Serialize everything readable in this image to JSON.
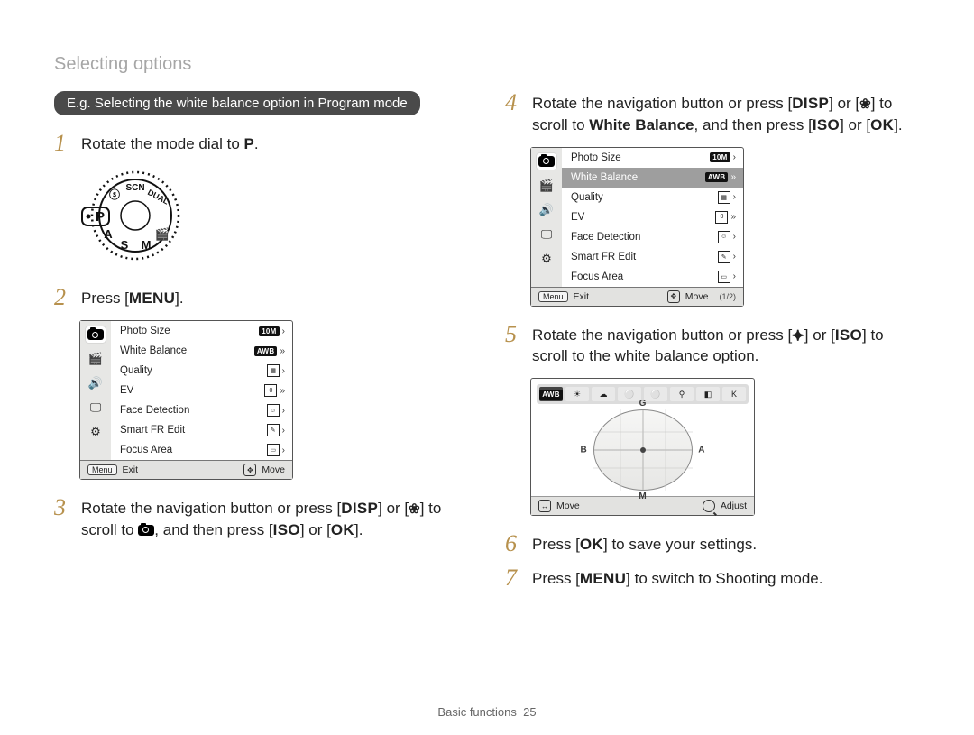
{
  "header": "Selecting options",
  "callout": "E.g. Selecting the white balance option in Program mode",
  "steps": {
    "s1_pre": "Rotate the mode dial to ",
    "s1_mode": "P",
    "s1_post": ".",
    "s2_pre": "Press [",
    "s2_btn": "MENU",
    "s2_post": "].",
    "s3_pre": "Rotate the navigation button or press [",
    "s3_b1": "DISP",
    "s3_mid1": "] or [",
    "s3_flower": "❀",
    "s3_mid2": "] to scroll to ",
    "s3_mid3": ", and then press [",
    "s3_b2": "ISO",
    "s3_mid4": "] or [",
    "s3_b3": "OK",
    "s3_post": "].",
    "s4_pre": "Rotate the navigation button or press [",
    "s4_b1": "DISP",
    "s4_mid1": "] or [",
    "s4_flower": "❀",
    "s4_mid2": "] to scroll to ",
    "s4_target": "White Balance",
    "s4_mid3": ", and then press [",
    "s4_b2": "ISO",
    "s4_mid4": "] or [",
    "s4_b3": "OK",
    "s4_post": "].",
    "s5_pre": "Rotate the navigation button or press [",
    "s5_b1": "⯌",
    "s5_mid1": "] or [",
    "s5_b2": "ISO",
    "s5_post": "] to scroll to the white balance option.",
    "s6_pre": "Press [",
    "s6_b1": "OK",
    "s6_post": "] to save your settings.",
    "s7_pre": "Press [",
    "s7_b1": "MENU",
    "s7_post": "] to switch to Shooting mode."
  },
  "menu": {
    "rows": [
      {
        "label": "Photo Size",
        "value": "10M"
      },
      {
        "label": "White Balance",
        "value": "AWB"
      },
      {
        "label": "Quality",
        "value": ""
      },
      {
        "label": "EV",
        "value": "0"
      },
      {
        "label": "Face Detection",
        "value": ""
      },
      {
        "label": "Smart FR Edit",
        "value": ""
      },
      {
        "label": "Focus Area",
        "value": ""
      }
    ],
    "footer": {
      "menu_pill": "Menu",
      "exit": "Exit",
      "move": "Move",
      "page": "(1/2)"
    }
  },
  "menu2_selected_index": 1,
  "wb": {
    "options": [
      "AWB",
      "☀",
      "☁",
      "⚪",
      "⚪",
      "⚲",
      "◧",
      "K"
    ],
    "chips_sel": 0,
    "axes": {
      "g": "G",
      "m": "M",
      "b": "B",
      "a": "A"
    },
    "footer": {
      "move": "Move",
      "adjust": "Adjust"
    }
  },
  "footer": {
    "section": "Basic functions",
    "page": "25"
  }
}
